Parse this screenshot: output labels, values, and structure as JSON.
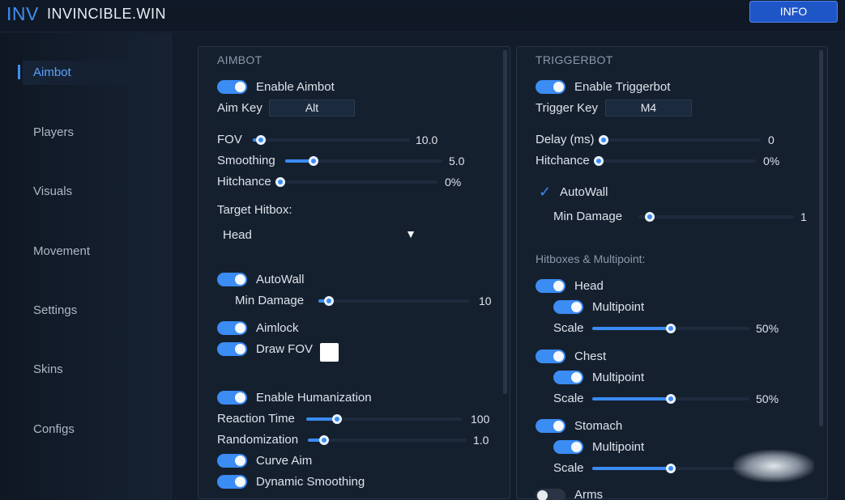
{
  "header": {
    "logo_abbr": "INV",
    "logo_name": "INVINCIBLE.WIN",
    "info_label": "INFO"
  },
  "sidebar": {
    "items": [
      {
        "label": "Aimbot",
        "active": true
      },
      {
        "label": "Players"
      },
      {
        "label": "Visuals"
      },
      {
        "label": "Movement"
      },
      {
        "label": "Settings"
      },
      {
        "label": "Skins"
      },
      {
        "label": "Configs"
      }
    ]
  },
  "aimbot": {
    "title": "AIMBOT",
    "enable_label": "Enable Aimbot",
    "aim_key_label": "Aim Key",
    "aim_key_value": "Alt",
    "fov": {
      "label": "FOV",
      "value": "10.0",
      "fraction": 0.05
    },
    "smoothing": {
      "label": "Smoothing",
      "value": "5.0",
      "fraction": 0.18
    },
    "hitchance": {
      "label": "Hitchance",
      "value": "0%",
      "fraction": 0.0
    },
    "target_hitbox_label": "Target Hitbox:",
    "target_hitbox_value": "Head",
    "autowall_label": "AutoWall",
    "min_damage": {
      "label": "Min Damage",
      "value": "10",
      "fraction": 0.07
    },
    "aimlock_label": "Aimlock",
    "draw_fov_label": "Draw FOV",
    "draw_fov_color": "#ffffff",
    "humanization_label": "Enable Humanization",
    "reaction_time": {
      "label": "Reaction Time",
      "value": "100",
      "fraction": 0.2
    },
    "randomization": {
      "label": "Randomization",
      "value": "1.0",
      "fraction": 0.1
    },
    "curve_aim_label": "Curve Aim",
    "dynamic_smoothing_label": "Dynamic Smoothing"
  },
  "triggerbot": {
    "title": "TRIGGERBOT",
    "enable_label": "Enable Triggerbot",
    "trigger_key_label": "Trigger Key",
    "trigger_key_value": "M4",
    "delay": {
      "label": "Delay (ms)",
      "value": "0",
      "fraction": 0.0
    },
    "hitchance": {
      "label": "Hitchance",
      "value": "0%",
      "fraction": 0.0
    },
    "autowall_label": "AutoWall",
    "min_damage": {
      "label": "Min Damage",
      "value": "1",
      "fraction": 0.0
    },
    "hitboxes_title": "Hitboxes & Multipoint:",
    "hitboxes": [
      {
        "name": "Head",
        "multipoint_label": "Multipoint",
        "scale_label": "Scale",
        "scale_value": "50%",
        "scale_fraction": 0.5
      },
      {
        "name": "Chest",
        "multipoint_label": "Multipoint",
        "scale_label": "Scale",
        "scale_value": "50%",
        "scale_fraction": 0.5
      },
      {
        "name": "Stomach",
        "multipoint_label": "Multipoint",
        "scale_label": "Scale",
        "scale_value": "",
        "scale_fraction": 0.5
      }
    ],
    "arms_label": "Arms"
  },
  "colors": {
    "accent": "#3b8cf3",
    "background": "#111a27",
    "panel": "#15202f"
  }
}
